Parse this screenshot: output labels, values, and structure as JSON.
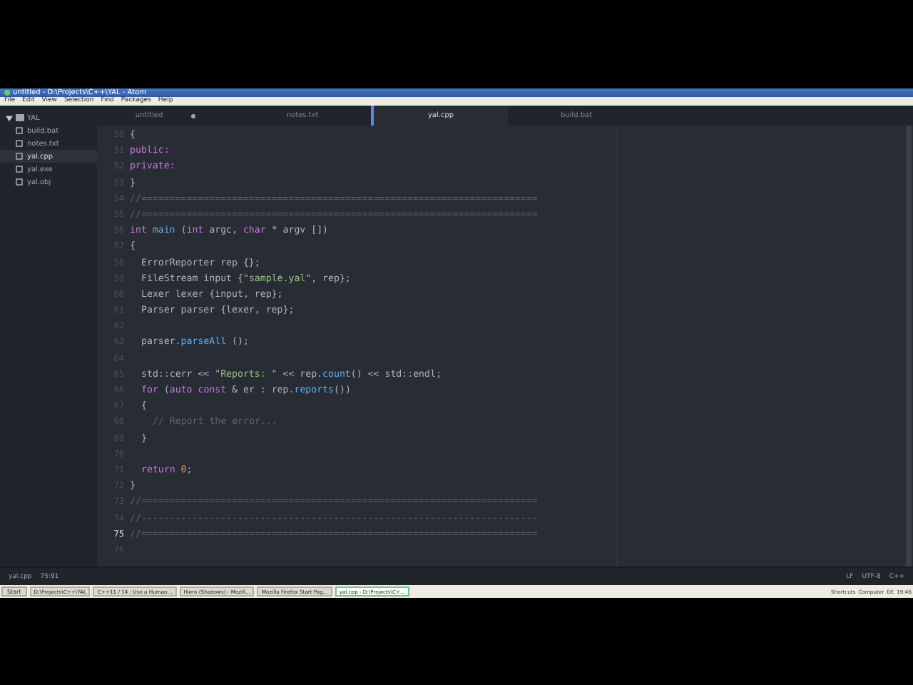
{
  "window": {
    "title": "untitled - D:\\Projects\\C++\\YAL - Atom"
  },
  "menu": [
    "File",
    "Edit",
    "View",
    "Selection",
    "Find",
    "Packages",
    "Help"
  ],
  "tree": {
    "root": "YAL",
    "expanded": true,
    "files": [
      {
        "name": "build.bat",
        "selected": false
      },
      {
        "name": "notes.txt",
        "selected": false
      },
      {
        "name": "yal.cpp",
        "selected": true
      },
      {
        "name": "yal.exe",
        "selected": false
      },
      {
        "name": "yal.obj",
        "selected": false
      }
    ]
  },
  "tabs": [
    {
      "label": "untitled",
      "selected": false,
      "modified": true
    },
    {
      "label": "notes.txt",
      "selected": false,
      "modified": false
    },
    {
      "label": "yal.cpp",
      "selected": true,
      "modified": false
    },
    {
      "label": "build.bat",
      "selected": false,
      "modified": false
    }
  ],
  "editor": {
    "lines": [
      {
        "number": "50",
        "selected": false,
        "kind": "top",
        "tokens": [
          {
            "kind": "plain",
            "text": "{"
          }
        ]
      },
      {
        "number": "51",
        "selected": false,
        "kind": "top",
        "tokens": [
          {
            "kind": "keyword",
            "text": "public:"
          }
        ]
      },
      {
        "number": "52",
        "selected": false,
        "kind": "top",
        "tokens": [
          {
            "kind": "keyword",
            "text": "private:"
          }
        ]
      },
      {
        "number": "53",
        "selected": false,
        "kind": "top",
        "tokens": [
          {
            "kind": "plain",
            "text": "}"
          }
        ]
      },
      {
        "number": "54",
        "selected": false,
        "kind": "top",
        "tokens": [
          {
            "kind": "comment",
            "text": "//======================================================================"
          }
        ]
      },
      {
        "number": "55",
        "selected": false,
        "kind": "top",
        "tokens": [
          {
            "kind": "comment",
            "text": "//======================================================================"
          }
        ]
      },
      {
        "number": "56",
        "selected": false,
        "kind": "top",
        "tokens": [
          {
            "kind": "keyword",
            "text": "int"
          },
          {
            "kind": "function",
            "text": " main"
          },
          {
            "kind": "plain",
            "text": " ("
          },
          {
            "kind": "keyword",
            "text": "int"
          },
          {
            "kind": "plain",
            "text": " argc, "
          },
          {
            "kind": "keyword",
            "text": "char"
          },
          {
            "kind": "plain",
            "text": " * argv [])"
          }
        ]
      },
      {
        "number": "57",
        "selected": false,
        "kind": "top",
        "tokens": [
          {
            "kind": "plain",
            "text": "{"
          }
        ]
      },
      {
        "number": "58",
        "selected": false,
        "kind": "body",
        "tokens": [
          {
            "kind": "plain",
            "text": "ErrorReporter rep {};"
          }
        ]
      },
      {
        "number": "59",
        "selected": false,
        "kind": "body",
        "tokens": [
          {
            "kind": "plain",
            "text": "FileStream input {"
          },
          {
            "kind": "string",
            "text": "\"sample.yal\""
          },
          {
            "kind": "plain",
            "text": ", rep};"
          }
        ]
      },
      {
        "number": "60",
        "selected": false,
        "kind": "body",
        "tokens": [
          {
            "kind": "plain",
            "text": "Lexer lexer {input, rep};"
          }
        ]
      },
      {
        "number": "61",
        "selected": false,
        "kind": "body",
        "tokens": [
          {
            "kind": "plain",
            "text": "Parser parser {lexer, rep};"
          }
        ]
      },
      {
        "number": "62",
        "selected": false
      },
      {
        "number": "63",
        "selected": false,
        "kind": "body",
        "tokens": [
          {
            "kind": "plain",
            "text": "parser."
          },
          {
            "kind": "function",
            "text": "parseAll"
          },
          {
            "kind": "plain",
            "text": " ();"
          }
        ]
      },
      {
        "number": "64",
        "selected": false
      },
      {
        "number": "65",
        "selected": false,
        "kind": "body",
        "tokens": [
          {
            "kind": "plain",
            "text": "std::cerr << "
          },
          {
            "kind": "string",
            "text": "\"Reports: \""
          },
          {
            "kind": "plain",
            "text": " << rep."
          },
          {
            "kind": "function",
            "text": "count"
          },
          {
            "kind": "plain",
            "text": "() << std::endl;"
          }
        ]
      },
      {
        "number": "66",
        "selected": false,
        "kind": "body",
        "tokens": [
          {
            "kind": "keyword",
            "text": "for"
          },
          {
            "kind": "plain",
            "text": " ("
          },
          {
            "kind": "keyword",
            "text": "auto const"
          },
          {
            "kind": "plain",
            "text": " & er : rep."
          },
          {
            "kind": "function",
            "text": "reports"
          },
          {
            "kind": "plain",
            "text": "())"
          }
        ]
      },
      {
        "number": "67",
        "selected": false,
        "kind": "body",
        "tokens": [
          {
            "kind": "plain",
            "text": "{"
          }
        ]
      },
      {
        "number": "68",
        "selected": false,
        "kind": "nested",
        "tokens": [
          {
            "kind": "comment",
            "text": "// Report the error..."
          }
        ]
      },
      {
        "number": "69",
        "selected": false,
        "kind": "body",
        "tokens": [
          {
            "kind": "plain",
            "text": "}"
          }
        ]
      },
      {
        "number": "70",
        "selected": false
      },
      {
        "number": "71",
        "selected": false,
        "kind": "body",
        "tokens": [
          {
            "kind": "keyword",
            "text": "return"
          },
          {
            "kind": "number",
            "text": " 0"
          },
          {
            "kind": "plain",
            "text": ";"
          }
        ]
      },
      {
        "number": "72",
        "selected": false,
        "kind": "top",
        "tokens": [
          {
            "kind": "plain",
            "text": "}"
          }
        ]
      },
      {
        "number": "73",
        "selected": false,
        "kind": "top",
        "tokens": [
          {
            "kind": "comment",
            "text": "//======================================================================"
          }
        ]
      },
      {
        "number": "74",
        "selected": false,
        "kind": "top",
        "tokens": [
          {
            "kind": "comment",
            "text": "//----------------------------------------------------------------------"
          }
        ]
      },
      {
        "number": "75",
        "selected": true,
        "kind": "top",
        "tokens": [
          {
            "kind": "comment",
            "text": "//======================================================================"
          }
        ]
      },
      {
        "number": "76",
        "selected": false
      }
    ]
  },
  "status_bar": {
    "file": "yal.cpp",
    "position": "75:91",
    "line_ending": "LF",
    "encoding": "UTF-8",
    "grammar": "C++"
  },
  "taskbar": {
    "start": "Start",
    "items": [
      {
        "label": "D:\\Projects\\C++\\YAL",
        "selected": false
      },
      {
        "label": "C++11 / 14 : Use a Human...",
        "selected": false
      },
      {
        "label": "Hiero (Shadows) - Mozill...",
        "selected": false
      },
      {
        "label": "Mozilla Firefox Start Pag...",
        "selected": false
      },
      {
        "label": "yal.cpp - D:\\Projects\\C+...",
        "selected": true
      }
    ],
    "tray": [
      "Shortcuts",
      "Computer",
      "DE"
    ],
    "clock": "19:46"
  }
}
